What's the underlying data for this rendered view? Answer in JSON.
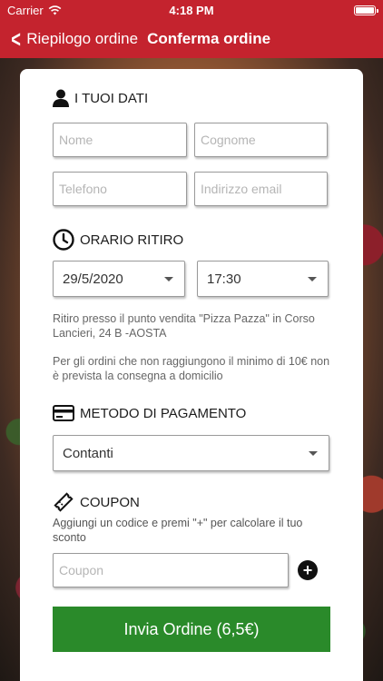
{
  "status_bar": {
    "carrier": "Carrier",
    "time": "4:18 PM"
  },
  "nav": {
    "back_label": "Riepilogo ordine",
    "title": "Conferma ordine"
  },
  "personal": {
    "title": "I TUOI DATI",
    "first_name_placeholder": "Nome",
    "last_name_placeholder": "Cognome",
    "phone_placeholder": "Telefono",
    "email_placeholder": "Indirizzo email"
  },
  "pickup": {
    "title": "ORARIO RITIRO",
    "date": "29/5/2020",
    "time": "17:30",
    "note1": "Ritiro presso il punto vendita \"Pizza Pazza\" in Corso Lancieri, 24 B -AOSTA",
    "note2": "Per gli ordini che non raggiungono il minimo di 10€ non è prevista la consegna a domicilio"
  },
  "payment": {
    "title": "METODO DI PAGAMENTO",
    "selected": "Contanti"
  },
  "coupon": {
    "title": "COUPON",
    "note": "Aggiungi un codice e premi \"+\" per calcolare il tuo sconto",
    "placeholder": "Coupon"
  },
  "submit_label": "Invia Ordine (6,5€)",
  "colors": {
    "brand_red": "#c4232e",
    "submit_green": "#2a8a2a"
  }
}
